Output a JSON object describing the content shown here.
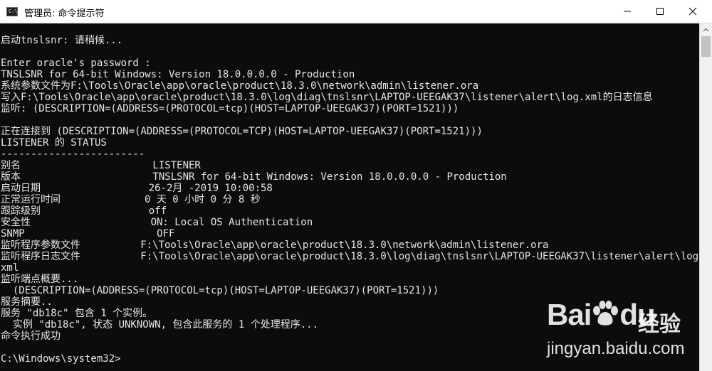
{
  "window": {
    "title": "管理员: 命令提示符",
    "icon": "console-app-icon",
    "controls": [
      "minimize-icon",
      "maximize-icon",
      "close-icon"
    ]
  },
  "terminal": {
    "colors": {
      "background": "#0c0c0c",
      "text": "#e6e6e6",
      "titlebar": "#ffffff"
    },
    "lines": [
      "",
      "启动tnslsnr: 请稍候...",
      "",
      "Enter oracle's password :",
      "TNSLSNR for 64-bit Windows: Version 18.0.0.0.0 - Production",
      "系统参数文件为F:\\Tools\\Oracle\\app\\oracle\\product\\18.3.0\\network\\admin\\listener.ora",
      "写入F:\\Tools\\Oracle\\app\\oracle\\product\\18.3.0\\log\\diag\\tnslsnr\\LAPTOP-UEEGAK37\\listener\\alert\\log.xml的日志信息",
      "监听: (DESCRIPTION=(ADDRESS=(PROTOCOL=tcp)(HOST=LAPTOP-UEEGAK37)(PORT=1521)))",
      "",
      "正在连接到 (DESCRIPTION=(ADDRESS=(PROTOCOL=TCP)(HOST=LAPTOP-UEEGAK37)(PORT=1521)))",
      "LISTENER 的 STATUS",
      "------------------------",
      "别名                      LISTENER",
      "版本                      TNSLSNR for 64-bit Windows: Version 18.0.0.0.0 - Production",
      "启动日期                  26-2月 -2019 10:00:58",
      "正常运行时间              0 天 0 小时 0 分 8 秒",
      "跟踪级别                  off",
      "安全性                    ON: Local OS Authentication",
      "SNMP                      OFF",
      "监听程序参数文件          F:\\Tools\\Oracle\\app\\oracle\\product\\18.3.0\\network\\admin\\listener.ora",
      "监听程序日志文件          F:\\Tools\\Oracle\\app\\oracle\\product\\18.3.0\\log\\diag\\tnslsnr\\LAPTOP-UEEGAK37\\listener\\alert\\log.",
      "xml",
      "监听端点概要...",
      "  (DESCRIPTION=(ADDRESS=(PROTOCOL=tcp)(HOST=LAPTOP-UEEGAK37)(PORT=1521)))",
      "服务摘要..",
      "服务 \"db18c\" 包含 1 个实例。",
      "  实例 \"db18c\", 状态 UNKNOWN, 包含此服务的 1 个处理程序...",
      "命令执行成功",
      "",
      "C:\\Windows\\system32>"
    ]
  },
  "watermark": {
    "brand": "Bai",
    "brand_mark": "paw-logo-icon",
    "brand_end": "du",
    "cn": "经验",
    "url": "jingyan.baidu.com"
  }
}
